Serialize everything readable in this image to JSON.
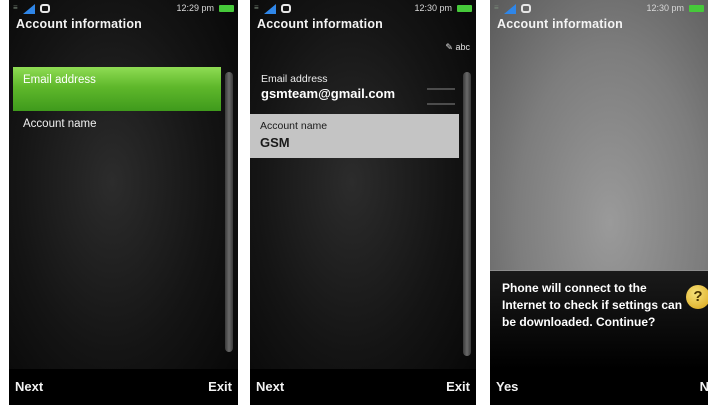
{
  "screens": [
    {
      "status": {
        "time": "12:29 pm"
      },
      "title": "Account information",
      "items": [
        {
          "label": "Email address",
          "selected": true
        },
        {
          "label": "Account name",
          "selected": false
        }
      ],
      "softkeys": {
        "left": "Next",
        "right": "Exit"
      }
    },
    {
      "status": {
        "time": "12:30 pm"
      },
      "title": "Account information",
      "input_mode": "abc",
      "fields": {
        "email": {
          "label": "Email address",
          "value": "gsmteam@gmail.com"
        },
        "account": {
          "label": "Account name",
          "value": "GSM"
        }
      },
      "softkeys": {
        "left": "Next",
        "right": "Exit"
      }
    },
    {
      "status": {
        "time": "12:30 pm"
      },
      "title": "Account information",
      "dialog": {
        "message": "Phone will connect to the Internet to check if settings can be downloaded. Continue?",
        "icon": "help-icon"
      },
      "softkeys": {
        "left": "Yes",
        "right": "No"
      }
    }
  ],
  "colors": {
    "selection_green": "#5fb82b",
    "battery_green": "#46c93a",
    "signal_blue": "#2f86e8",
    "help_yellow": "#e8b82a"
  }
}
